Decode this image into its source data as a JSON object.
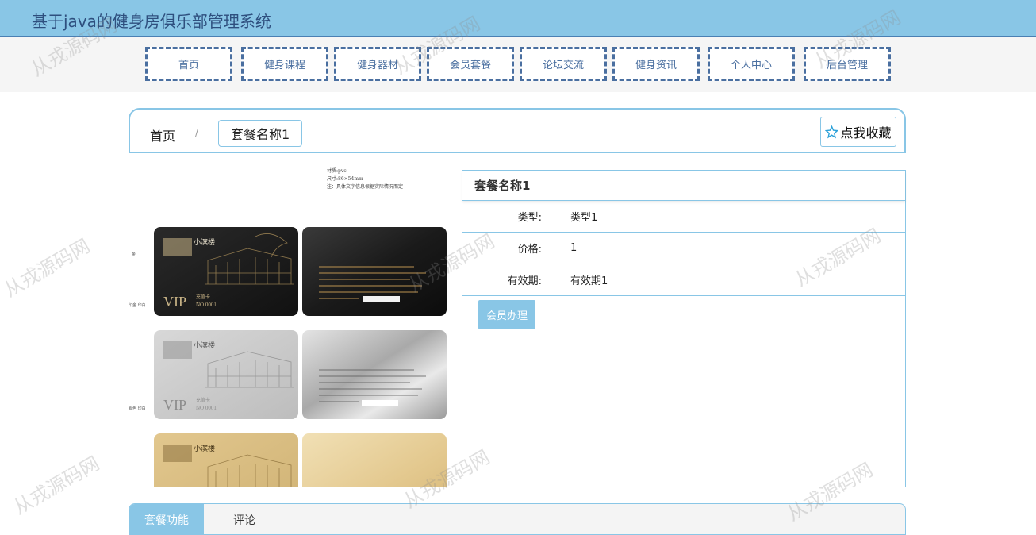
{
  "header": {
    "title": "基于java的健身房俱乐部管理系统"
  },
  "nav": {
    "items": [
      {
        "label": "首页"
      },
      {
        "label": "健身课程"
      },
      {
        "label": "健身器材"
      },
      {
        "label": "会员套餐"
      },
      {
        "label": "论坛交流"
      },
      {
        "label": "健身资讯"
      },
      {
        "label": "个人中心"
      },
      {
        "label": "后台管理"
      }
    ]
  },
  "breadcrumb": {
    "home": "首页",
    "separator": "/",
    "current": "套餐名称1"
  },
  "favorite": {
    "label": "点我收藏",
    "icon": "star-outline-icon"
  },
  "product_image": {
    "spec_lines": [
      "材质:pvc",
      "尺寸:86×54mm",
      "注：具体文字信息根据实际情况而定"
    ],
    "cards": [
      {
        "brand": "小滨楼",
        "vip": "VIP",
        "card_type": "充值卡",
        "number": "NO 0001",
        "style": "black"
      },
      {
        "brand": "小滨楼",
        "vip": "VIP",
        "card_type": "充值卡",
        "number": "NO 0001",
        "style": "silver"
      },
      {
        "brand": "小滨楼",
        "style": "gold"
      }
    ],
    "side_labels": [
      "金",
      "印金 印白",
      "银色 印白"
    ]
  },
  "detail": {
    "title": "套餐名称1",
    "rows": [
      {
        "label": "类型:",
        "value": "类型1"
      },
      {
        "label": "价格:",
        "value": "1"
      },
      {
        "label": "有效期:",
        "value": "有效期1"
      }
    ],
    "action_label": "会员办理"
  },
  "tabs": [
    {
      "label": "套餐功能",
      "active": true
    },
    {
      "label": "评论",
      "active": false
    }
  ],
  "watermark_text": "从戎源码网",
  "colors": {
    "primary": "#89c6e6",
    "nav_border": "#4a6fa0",
    "title_text": "#2e4f7e"
  }
}
